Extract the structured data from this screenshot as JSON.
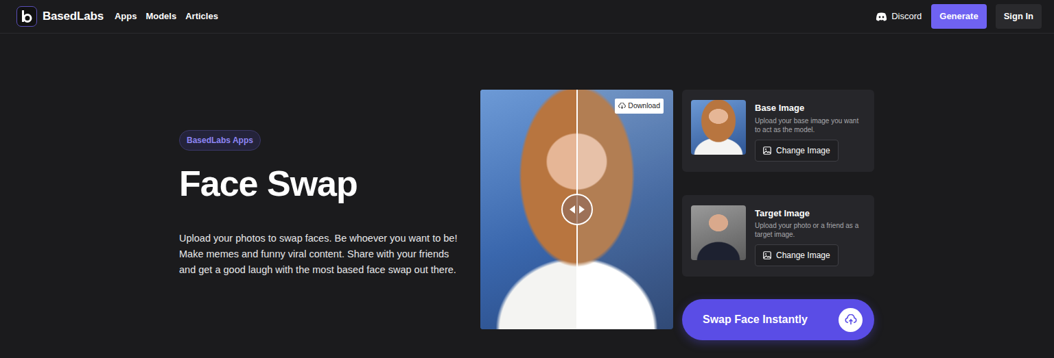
{
  "nav": {
    "brand": "BasedLabs",
    "links": [
      {
        "label": "Apps"
      },
      {
        "label": "Models"
      },
      {
        "label": "Articles"
      }
    ],
    "discord": "Discord",
    "generate": "Generate",
    "sign_in": "Sign In"
  },
  "hero": {
    "badge": "BasedLabs Apps",
    "title": "Face Swap",
    "description": "Upload your photos to swap faces. Be whoever you want to be! Make memes and funny viral content. Share with your friends and get a good laugh with the most based face swap out there."
  },
  "preview": {
    "download": "Download",
    "level": 0.5
  },
  "inputs": [
    {
      "kind": "base",
      "title": "Base Image",
      "description": "Upload your base image you want to act as the model.",
      "button": "Change Image"
    },
    {
      "kind": "target",
      "title": "Target Image",
      "description": "Upload your photo or a friend as a target image.",
      "button": "Change Image"
    }
  ],
  "action": {
    "label": "Swap Face Instantly"
  }
}
